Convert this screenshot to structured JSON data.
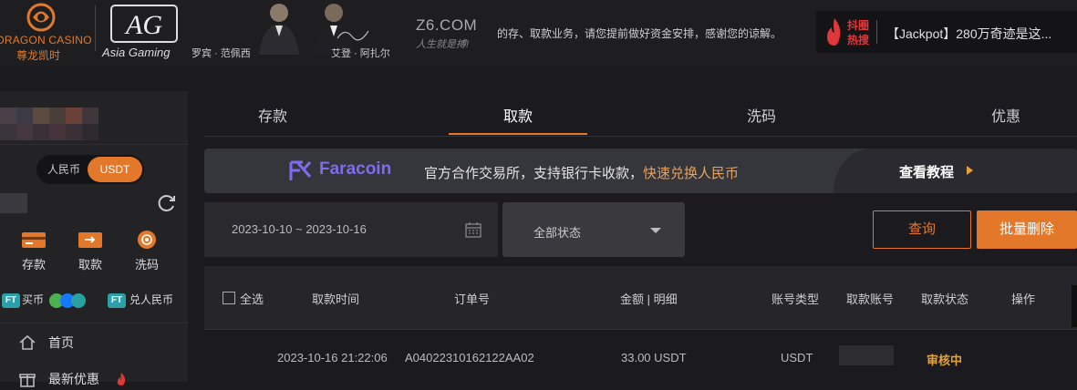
{
  "header": {
    "brand1_name": "DRAGON CASINO",
    "brand1_cn": "尊龙凯时",
    "brand2_sub": "Asia Gaming",
    "ambassador1": "罗宾 · 范佩西",
    "ambassador2": "艾登 · 阿扎尔",
    "site_name": "Z6.COM",
    "site_slogan": "人生就是搏!",
    "notice": "的存、取款业务，请您提前做好资金安排，感谢您的谅解。",
    "hot_tag": "抖圈热搜",
    "hot_text": "【Jackpot】280万奇迹是这..."
  },
  "sidebar": {
    "currency_rmb": "人民币",
    "currency_usdt": "USDT",
    "quick_actions": [
      {
        "label": "存款"
      },
      {
        "label": "取款"
      },
      {
        "label": "洗码"
      }
    ],
    "buy_coin": "买币",
    "exchange_rmb": "兑人民币",
    "ft_badge": "FT",
    "nav": [
      {
        "label": "首页"
      },
      {
        "label": "最新优惠"
      }
    ]
  },
  "tabs": [
    {
      "label": "存款",
      "active": false
    },
    {
      "label": "取款",
      "active": true
    },
    {
      "label": "洗码",
      "active": false
    },
    {
      "label": "优惠",
      "active": false
    }
  ],
  "promo": {
    "brand": "Faracoin",
    "text": "官方合作交易所，支持银行卡收款，",
    "highlight": "快速兑换人民币",
    "link": "查看教程"
  },
  "filters": {
    "date_range": "2023-10-10 ~ 2023-10-16",
    "status": "全部状态",
    "query_button": "查询",
    "batch_delete_button": "批量删除"
  },
  "table": {
    "select_all": "全选",
    "columns": [
      "取款时间",
      "订单号",
      "金额 | 明细",
      "账号类型",
      "取款账号",
      "取款状态",
      "操作"
    ],
    "rows": [
      {
        "time": "2023-10-16 21:22:06",
        "order": "A04022310162122AA02",
        "amount": "33.00 USDT",
        "account_type": "USDT",
        "status": "审核中"
      }
    ]
  },
  "colors": {
    "accent": "#e3782a",
    "faracoin": "#7e6cf0",
    "status_pending": "#e3a23a",
    "background": "#1b1b1f"
  }
}
